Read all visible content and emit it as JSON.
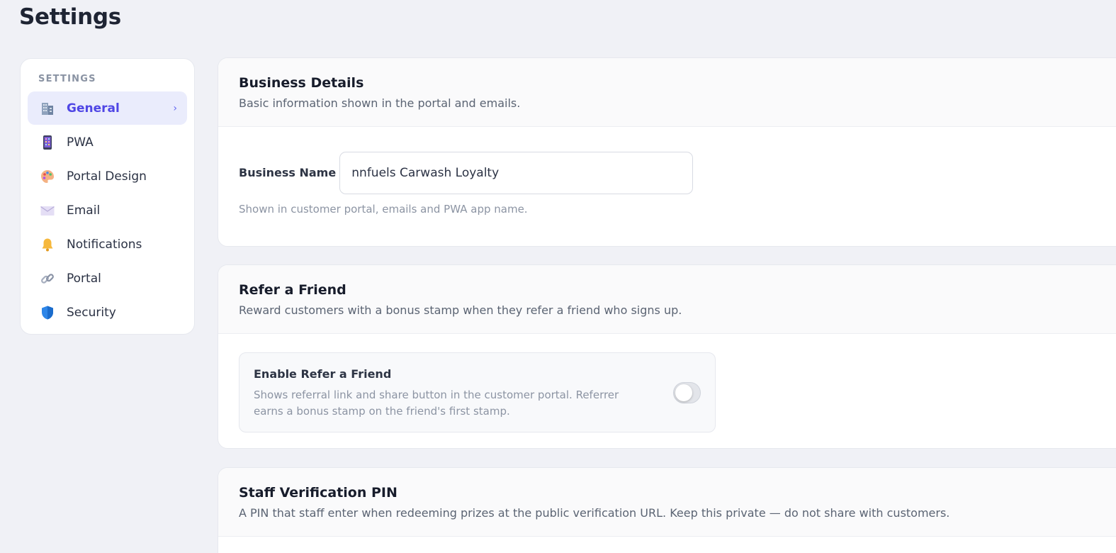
{
  "page": {
    "title": "Settings"
  },
  "sidebar": {
    "heading": "SETTINGS",
    "items": [
      {
        "label": "General",
        "icon": "building-icon",
        "active": true
      },
      {
        "label": "PWA",
        "icon": "phone-icon"
      },
      {
        "label": "Portal Design",
        "icon": "palette-icon"
      },
      {
        "label": "Email",
        "icon": "envelope-icon"
      },
      {
        "label": "Notifications",
        "icon": "bell-icon"
      },
      {
        "label": "Portal",
        "icon": "link-icon"
      },
      {
        "label": "Security",
        "icon": "shield-icon"
      }
    ],
    "active_chevron": "›"
  },
  "business": {
    "title": "Business Details",
    "subtitle": "Basic information shown in the portal and emails.",
    "name_label": "Business Name",
    "name_value": "nnfuels Carwash Loyalty",
    "name_help": "Shown in customer portal, emails and PWA app name."
  },
  "refer": {
    "title": "Refer a Friend",
    "subtitle": "Reward customers with a bonus stamp when they refer a friend who signs up.",
    "toggle_title": "Enable Refer a Friend",
    "toggle_desc": "Shows referral link and share button in the customer portal. Referrer earns a bonus stamp on the friend's first stamp.",
    "enabled": false
  },
  "pin": {
    "title": "Staff Verification PIN",
    "subtitle": "A PIN that staff enter when redeeming prizes at the public verification URL. Keep this private — do not share with customers."
  },
  "colors": {
    "accent": "#4f46e5",
    "active_bg": "#eaecfc",
    "background": "#f0f1f6"
  }
}
